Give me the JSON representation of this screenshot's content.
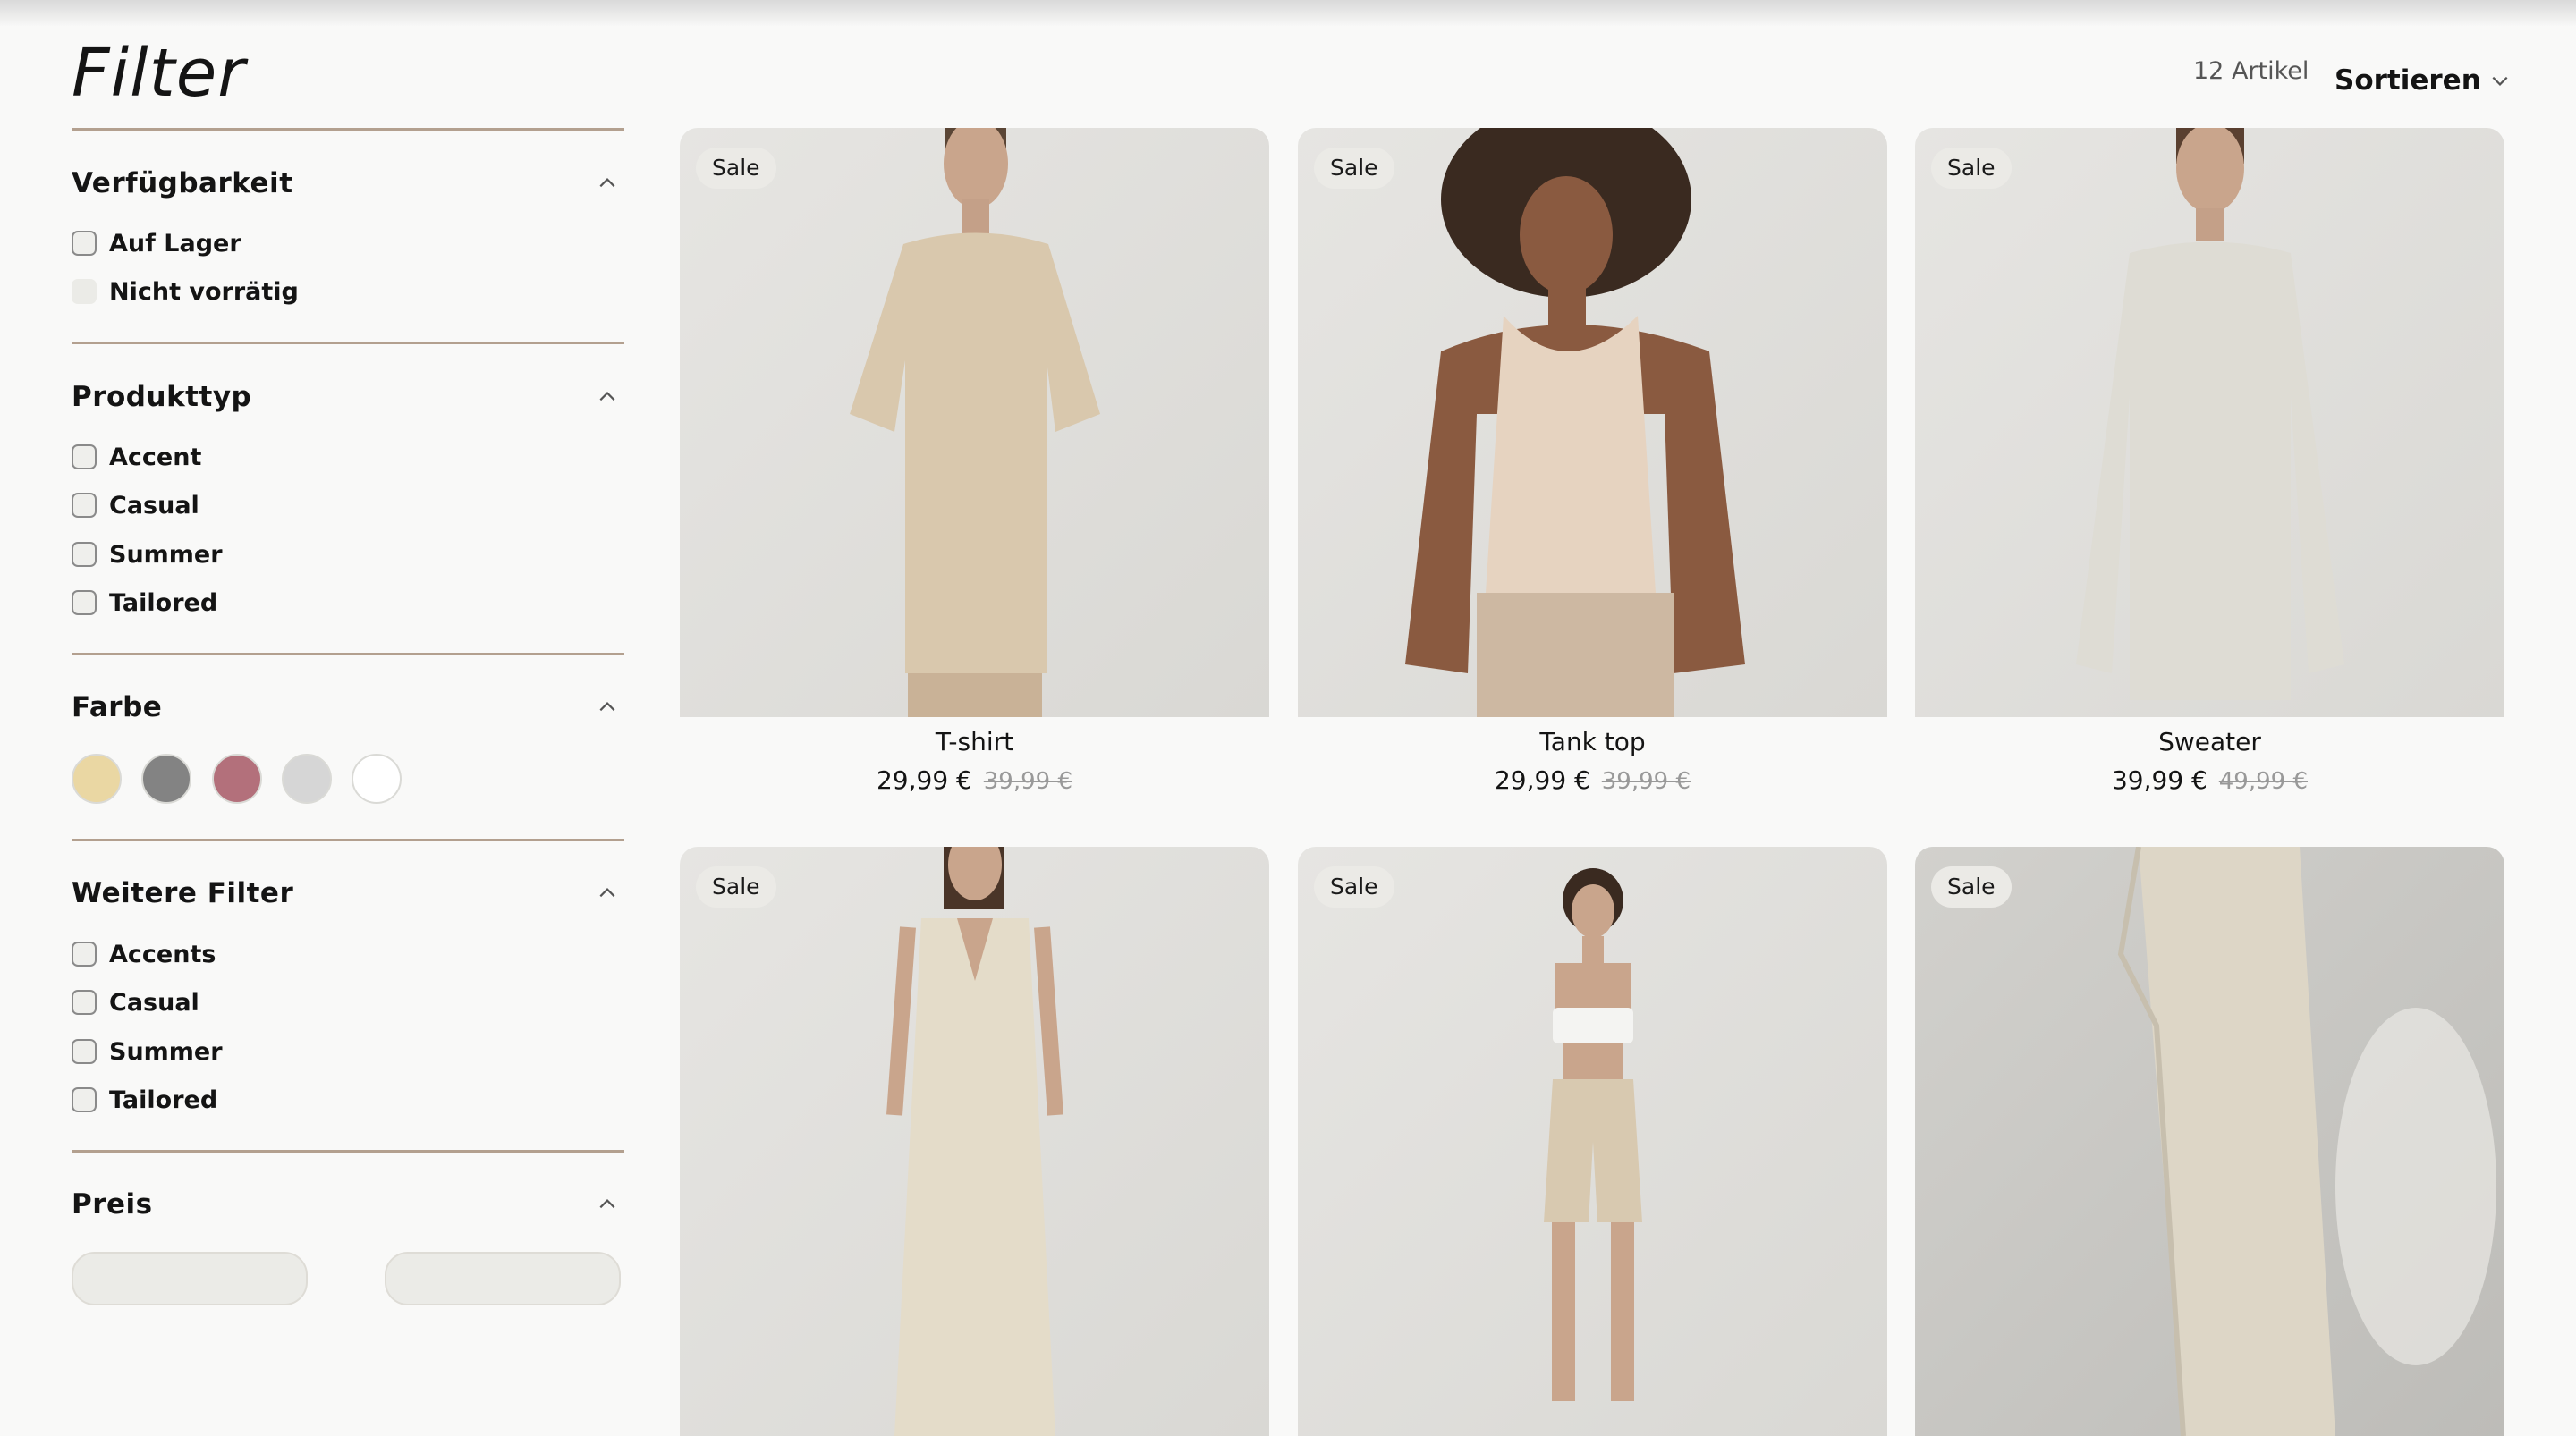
{
  "page": {
    "filter_title": "Filter",
    "item_count": "12 Artikel",
    "sort_label": "Sortieren"
  },
  "filters": {
    "availability": {
      "title": "Verfügbarkeit",
      "options": [
        {
          "label": "Auf Lager",
          "disabled": false
        },
        {
          "label": "Nicht vorrätig",
          "disabled": true
        }
      ]
    },
    "product_type": {
      "title": "Produkttyp",
      "options": [
        {
          "label": "Accent"
        },
        {
          "label": "Casual"
        },
        {
          "label": "Summer"
        },
        {
          "label": "Tailored"
        }
      ]
    },
    "color": {
      "title": "Farbe",
      "swatches": [
        {
          "name": "beige",
          "hex": "#ead7a3"
        },
        {
          "name": "gray",
          "hex": "#838383"
        },
        {
          "name": "rose",
          "hex": "#b3707b"
        },
        {
          "name": "light-gray",
          "hex": "#d6d6d6"
        },
        {
          "name": "white",
          "hex": "#ffffff"
        }
      ]
    },
    "more": {
      "title": "Weitere Filter",
      "options": [
        {
          "label": "Accents"
        },
        {
          "label": "Casual"
        },
        {
          "label": "Summer"
        },
        {
          "label": "Tailored"
        }
      ]
    },
    "price": {
      "title": "Preis"
    }
  },
  "products": [
    {
      "badge": "Sale",
      "name": "T-shirt",
      "price": "29,99 €",
      "old_price": "39,99 €",
      "image": "model-tshirt-photo",
      "garment_color": "#d9c8ad"
    },
    {
      "badge": "Sale",
      "name": "Tank top",
      "price": "29,99 €",
      "old_price": "39,99 €",
      "image": "model-tanktop-photo",
      "garment_color": "#e6d3c0"
    },
    {
      "badge": "Sale",
      "name": "Sweater",
      "price": "39,99 €",
      "old_price": "49,99 €",
      "image": "model-sweater-photo",
      "garment_color": "#dedcd4"
    },
    {
      "badge": "Sale",
      "name": "",
      "price": "",
      "old_price": "",
      "image": "model-dress-photo",
      "garment_color": "#e4dcc9"
    },
    {
      "badge": "Sale",
      "name": "",
      "price": "",
      "old_price": "",
      "image": "model-shorts-photo",
      "garment_color": "#d8c9b0"
    },
    {
      "badge": "Sale",
      "name": "",
      "price": "",
      "old_price": "",
      "image": "model-trousers-photo",
      "garment_color": "#ddd6c6"
    }
  ],
  "colors": {
    "background": "#f9f9f8",
    "divider": "#b3a08f",
    "text": "#141414",
    "muted_text": "#999999",
    "badge_bg": "#ebeae6"
  },
  "icons": {
    "section_toggle": "chevron-up-icon",
    "sort_toggle": "chevron-down-icon"
  }
}
